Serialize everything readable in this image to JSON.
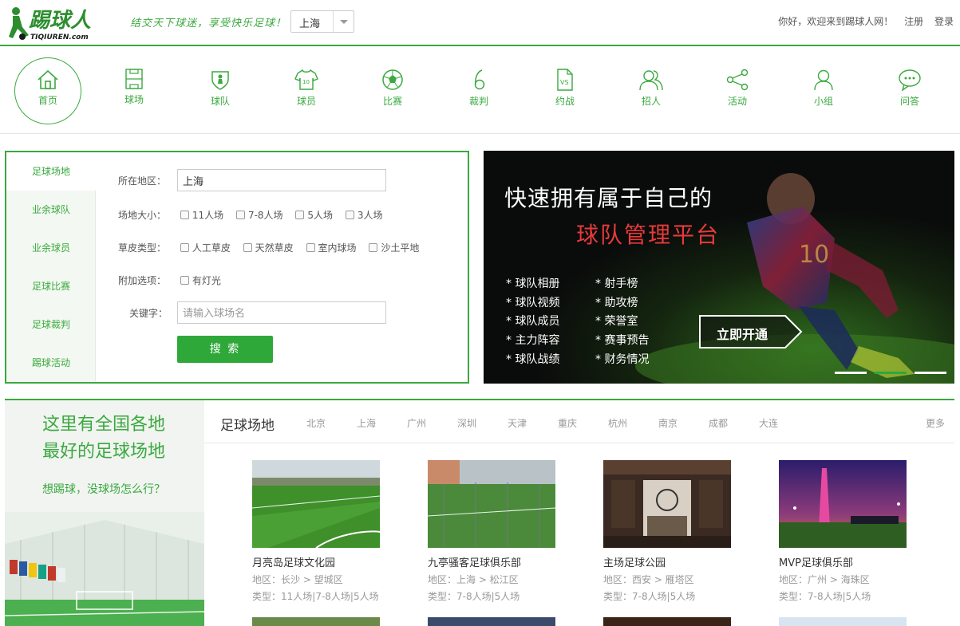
{
  "header": {
    "slogan": "结交天下球迷，享受快乐足球！",
    "city": "上海",
    "welcome": "你好，欢迎来到踢球人网！",
    "register": "注册",
    "login": "登录"
  },
  "nav": [
    {
      "label": "首页",
      "icon": "home-icon"
    },
    {
      "label": "球场",
      "icon": "pitch-icon"
    },
    {
      "label": "球队",
      "icon": "team-icon"
    },
    {
      "label": "球员",
      "icon": "jersey-icon"
    },
    {
      "label": "比赛",
      "icon": "ball-icon"
    },
    {
      "label": "裁判",
      "icon": "whistle-icon"
    },
    {
      "label": "约战",
      "icon": "vs-icon"
    },
    {
      "label": "招人",
      "icon": "people-icon"
    },
    {
      "label": "活动",
      "icon": "share-icon"
    },
    {
      "label": "小组",
      "icon": "user-icon"
    },
    {
      "label": "问答",
      "icon": "chat-icon"
    }
  ],
  "search": {
    "tabs": [
      "足球场地",
      "业余球队",
      "业余球员",
      "足球比赛",
      "足球裁判",
      "踢球活动"
    ],
    "region_label": "所在地区：",
    "region_value": "上海",
    "size_label": "场地大小：",
    "sizes": [
      "11人场",
      "7-8人场",
      "5人场",
      "3人场"
    ],
    "turf_label": "草皮类型：",
    "turfs": [
      "人工草皮",
      "天然草皮",
      "室内球场",
      "沙土平地"
    ],
    "extra_label": "附加选项：",
    "extras": [
      "有灯光"
    ],
    "keyword_label": "关键字：",
    "keyword_placeholder": "请输入球场名",
    "button": "搜 索"
  },
  "banner": {
    "line1": "快速拥有属于自己的",
    "line2": "球队管理平台",
    "features_left": [
      "球队相册",
      "球队视频",
      "球队成员",
      "主力阵容",
      "球队战绩"
    ],
    "features_right": [
      "射手榜",
      "助攻榜",
      "荣誉室",
      "赛事预告",
      "财务情况"
    ],
    "cta": "立即开通",
    "active_slide": 2
  },
  "promo": {
    "title_line1": "这里有全国各地",
    "title_line2": "最好的足球场地",
    "subtitle": "想踢球，没球场怎么行？"
  },
  "fields": {
    "title": "足球场地",
    "cities": [
      "北京",
      "上海",
      "广州",
      "深圳",
      "天津",
      "重庆",
      "杭州",
      "南京",
      "成都",
      "大连"
    ],
    "more": "更多",
    "cards": [
      {
        "name": "月亮岛足球文化园",
        "region": "地区：长沙 > 望城区",
        "type": "类型：11人场|7-8人场|5人场"
      },
      {
        "name": "九亭骚客足球俱乐部",
        "region": "地区：上海 > 松江区",
        "type": "类型：7-8人场|5人场"
      },
      {
        "name": "主场足球公园",
        "region": "地区：西安 > 雁塔区",
        "type": "类型：7-8人场|5人场"
      },
      {
        "name": "MVP足球俱乐部",
        "region": "地区：广州 > 海珠区",
        "type": "类型：7-8人场|5人场"
      }
    ]
  },
  "colors": {
    "brand_green": "#3aa93f",
    "banner_red": "#e73a3a"
  }
}
